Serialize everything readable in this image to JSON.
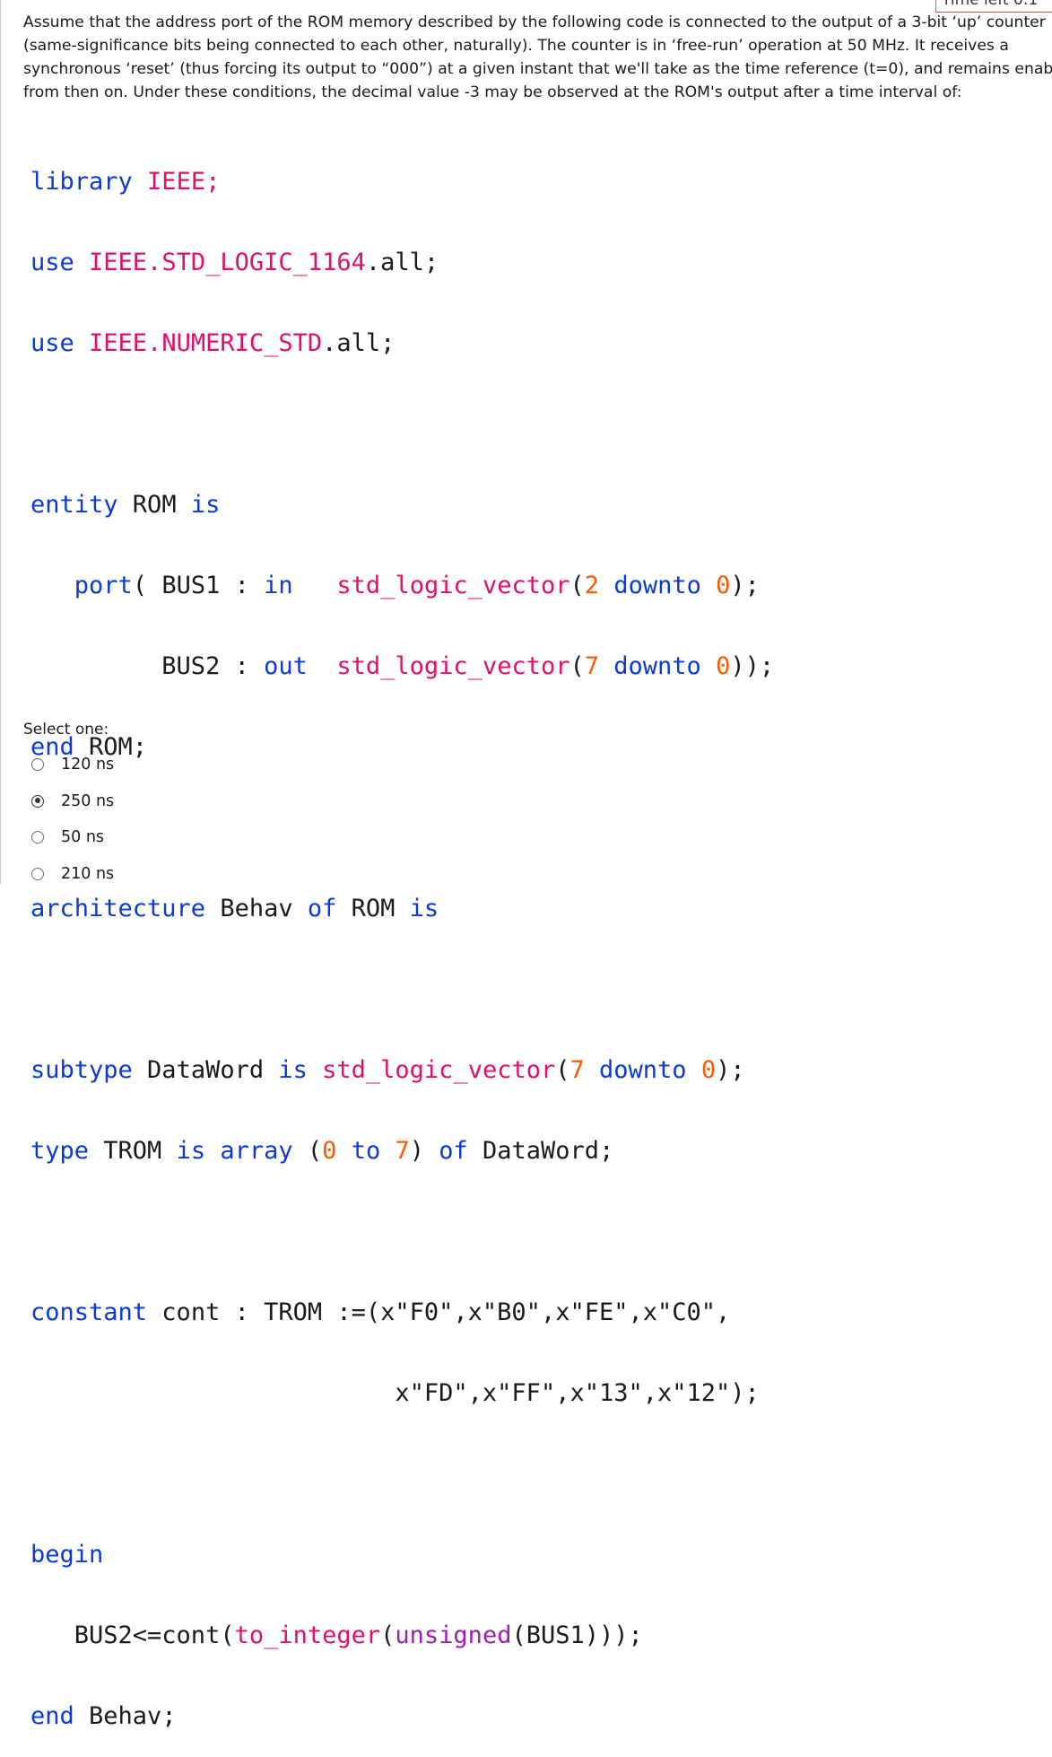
{
  "timer": {
    "text": "Time left 0:1"
  },
  "question": {
    "line1": "Assume that the address port of the ROM memory described by the following code is connected to the output of a 3-bit ‘up’ counter",
    "line2": "(same-significance bits being connected to each other, naturally). The counter is in ‘free-run’ operation at 50 MHz. It receives a",
    "line3": "synchronous ‘reset’ (thus forcing its output to “000”) at a given instant that we'll take as the time reference (t=0), and remains enabled",
    "line4": "from then on. Under these conditions, the decimal value -3 may be observed at the ROM's output after a time interval of:"
  },
  "code": {
    "l1": [
      "library",
      " IEEE;"
    ],
    "l2": [
      "use",
      " IEEE.STD_LOGIC_1164",
      ".all;"
    ],
    "l3": [
      "use",
      " IEEE.NUMERIC_STD",
      ".all;"
    ],
    "l5": [
      "entity",
      " ROM ",
      "is"
    ],
    "l6": [
      "   ",
      "port",
      "( BUS1 : ",
      "in",
      "   ",
      "std_logic_vector",
      "(",
      "2",
      " ",
      "downto",
      " ",
      "0",
      ");"
    ],
    "l7": [
      "         BUS2 : ",
      "out",
      "  ",
      "std_logic_vector",
      "(",
      "7",
      " ",
      "downto",
      " ",
      "0",
      "));"
    ],
    "l8": [
      "end",
      " ROM;"
    ],
    "l10": [
      "architecture",
      " Behav ",
      "of",
      " ROM ",
      "is"
    ],
    "l12": [
      "subtype",
      " DataWord ",
      "is",
      " ",
      "std_logic_vector",
      "(",
      "7",
      " ",
      "downto",
      " ",
      "0",
      ");"
    ],
    "l13": [
      "type",
      " TROM ",
      "is",
      " ",
      "array",
      " (",
      "0",
      " ",
      "to",
      " ",
      "7",
      ") ",
      "of",
      " DataWord;"
    ],
    "l15": [
      "constant",
      " cont : TROM :=(x\"F0\",x\"B0\",x\"FE\",x\"C0\","
    ],
    "l16": [
      "                         x\"FD\",x\"FF\",x\"13\",x\"12\");"
    ],
    "l18": [
      "begin"
    ],
    "l19": [
      "   BUS2<=cont(",
      "to_integer",
      "(",
      "unsigned",
      "(BUS1)));"
    ],
    "l20": [
      "end",
      " Behav;"
    ]
  },
  "select_label": "Select one:",
  "options": [
    {
      "label": "120 ns",
      "checked": false
    },
    {
      "label": "250 ns",
      "checked": true
    },
    {
      "label": "50 ns",
      "checked": false
    },
    {
      "label": "210 ns",
      "checked": false
    }
  ]
}
